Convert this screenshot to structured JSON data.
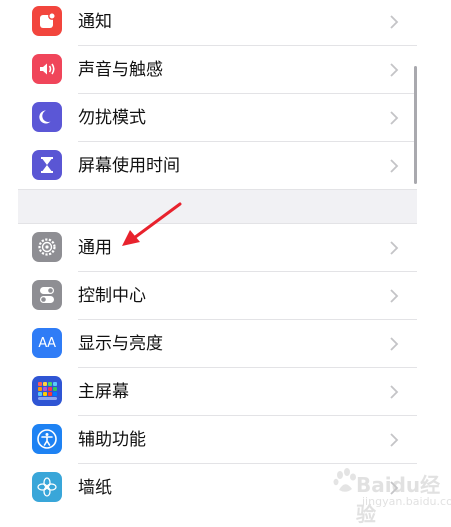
{
  "settings": {
    "group1": [
      {
        "label": "通知",
        "icon": "notification-icon",
        "color": "#f2453d"
      },
      {
        "label": "声音与触感",
        "icon": "speaker-icon",
        "color": "#f0455a"
      },
      {
        "label": "勿扰模式",
        "icon": "moon-icon",
        "color": "#5b57d6"
      },
      {
        "label": "屏幕使用时间",
        "icon": "hourglass-icon",
        "color": "#5a56d4"
      }
    ],
    "group2": [
      {
        "label": "通用",
        "icon": "gear-icon",
        "color": "#8e8e93"
      },
      {
        "label": "控制中心",
        "icon": "toggles-icon",
        "color": "#8e8e93"
      },
      {
        "label": "显示与亮度",
        "icon": "text-size-icon",
        "color": "#2f7cf6"
      },
      {
        "label": "主屏幕",
        "icon": "home-grid-icon",
        "color": "#2f55d4"
      },
      {
        "label": "辅助功能",
        "icon": "accessibility-icon",
        "color": "#1e82f3"
      },
      {
        "label": "墙纸",
        "icon": "flower-icon",
        "color": "#39a6d9"
      }
    ]
  },
  "icon_text": {
    "display": "AA"
  },
  "annotation": {
    "arrow_color": "#e8222d"
  },
  "watermark": {
    "text": "Baidu经验",
    "sub": "jingyan.baidu.com"
  }
}
